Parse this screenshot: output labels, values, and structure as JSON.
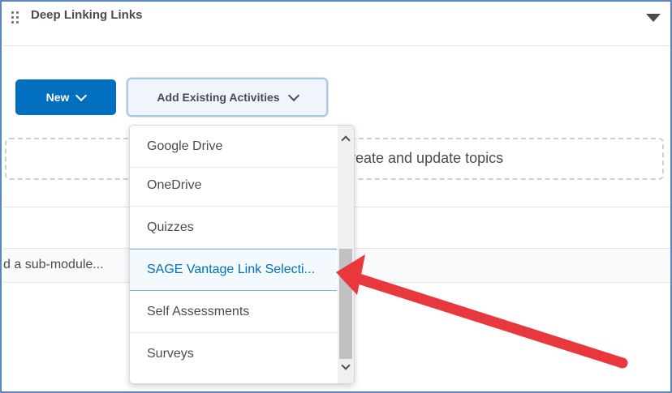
{
  "module": {
    "title": "Deep Linking Links",
    "drag_handle_icon": "grip-dots-icon",
    "collapse_icon": "caret-down-icon"
  },
  "toolbar": {
    "new_label": "New",
    "add_existing_label": "Add Existing Activities"
  },
  "dropzone": {
    "text": "reate and update topics"
  },
  "submodule": {
    "text": "d a sub-module..."
  },
  "dropdown": {
    "items": [
      {
        "label": "Google Drive"
      },
      {
        "label": "OneDrive"
      },
      {
        "label": "Quizzes"
      },
      {
        "label": "SAGE Vantage Link Selecti..."
      },
      {
        "label": "Self Assessments"
      },
      {
        "label": "Surveys"
      }
    ],
    "selected_index": 3
  },
  "colors": {
    "primary_button": "#006fbf",
    "frame_border": "#5b85c1",
    "annotation_arrow": "#e8383d"
  }
}
